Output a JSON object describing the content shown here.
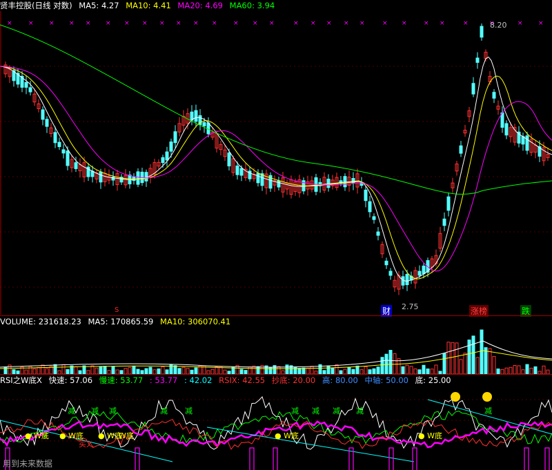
{
  "header": {
    "title": "贤丰控股(日线 对数)",
    "ma5_label": "MA5:",
    "ma5_value": "4.27",
    "ma10_label": "MA10:",
    "ma10_value": "4.41",
    "ma20_label": "MA20:",
    "ma20_value": "4.69",
    "ma60_label": "MA60:",
    "ma60_value": "3.94"
  },
  "price_panel": {
    "high_label": "8.20",
    "low_label": "2.75",
    "cai_marker": "财",
    "zhangbang_marker": "涨榜",
    "die_marker": "跌",
    "s_marker": "S"
  },
  "volume_header": {
    "volume_label": "VOLUME:",
    "volume_value": "231618.23",
    "ma5_label": "MA5:",
    "ma5_value": "170865.59",
    "ma10_label": "MA10:",
    "ma10_value": "306070.41"
  },
  "rsi_header": {
    "title": "RSI之W底X",
    "fast_label": "快速:",
    "fast_value": "57.06",
    "slow_label": "慢速:",
    "slow_value": "53.77",
    "v3_label": ":",
    "v3_value": "53.77",
    "v4_label": ":",
    "v4_value": "42.02",
    "rsix_label": "RSIX:",
    "rsix_value": "42.55",
    "chaodi_label": "抄底:",
    "chaodi_value": "20.00",
    "high_label": "高:",
    "high_value": "80.00",
    "mid_label": "中轴:",
    "mid_value": "50.00",
    "low_label": "底:",
    "low_value": "25.00"
  },
  "rsi_panel": {
    "jian": "减",
    "wdi": "W底",
    "buy_tag": "买入",
    "footer_text": "用到未来数据"
  },
  "colors": {
    "background": "#000000",
    "up_candle": "#ff3232",
    "down_candle": "#54ffff",
    "ma5": "#ffffff",
    "ma10": "#ffff00",
    "ma20": "#ff00ff",
    "ma60": "#00ff00",
    "grid": "#a00000"
  }
}
